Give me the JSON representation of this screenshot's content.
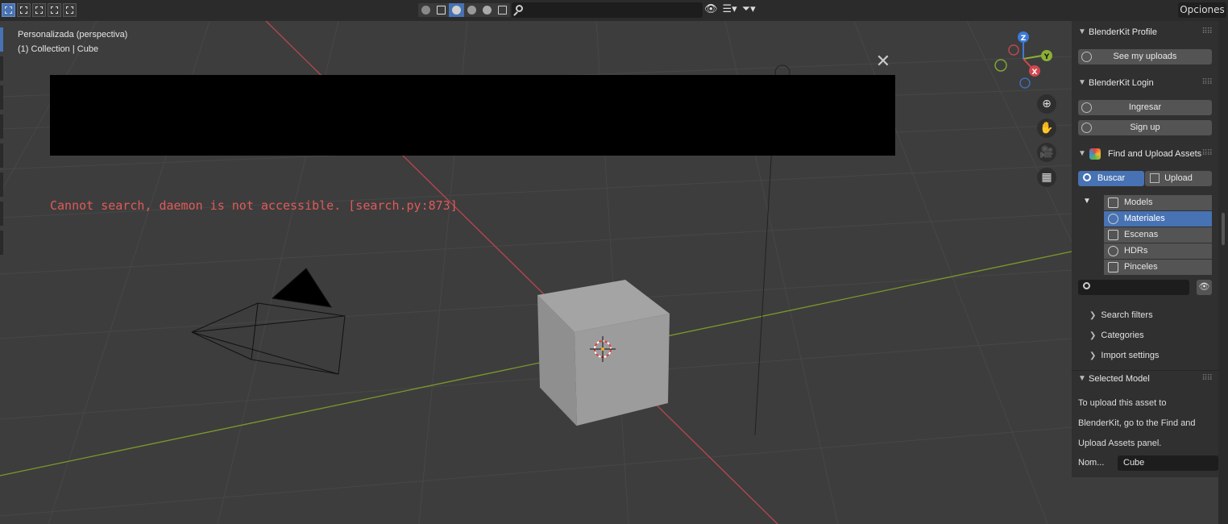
{
  "header": {
    "search_placeholder": "",
    "options_label": "Opciones"
  },
  "viewport": {
    "view_label": "Personalizada (perspectiva)",
    "collection_label": "(1) Collection | Cube",
    "error_message": "Cannot search, daemon is not accessible. [search.py:873]",
    "gizmo": {
      "z": "Z",
      "y": "Y",
      "x": "X"
    }
  },
  "panel": {
    "profile": {
      "title": "BlenderKit Profile",
      "see_uploads": "See my uploads"
    },
    "login": {
      "title": "BlenderKit Login",
      "login_button": "Ingresar",
      "signup_button": "Sign up"
    },
    "find_upload": {
      "title": "Find and Upload Assets",
      "tab_search": "Buscar",
      "tab_upload": "Upload",
      "categories": [
        "Models",
        "Materiales",
        "Escenas",
        "HDRs",
        "Pinceles"
      ],
      "selected_category": "Materiales",
      "search_value": "",
      "search_filters": "Search filters",
      "categories_label": "Categories",
      "import_settings": "Import settings"
    },
    "selected_model": {
      "title": "Selected Model",
      "info_line1": "To upload this asset to",
      "info_line2": "BlenderKit, go to the Find and",
      "info_line3": "Upload Assets panel.",
      "name_label": "Nom...",
      "name_value": "Cube"
    }
  },
  "colors": {
    "accent": "#4772b3",
    "error": "#e05a5a",
    "x_axis": "#c8424d",
    "y_axis": "#7a9a2a"
  }
}
